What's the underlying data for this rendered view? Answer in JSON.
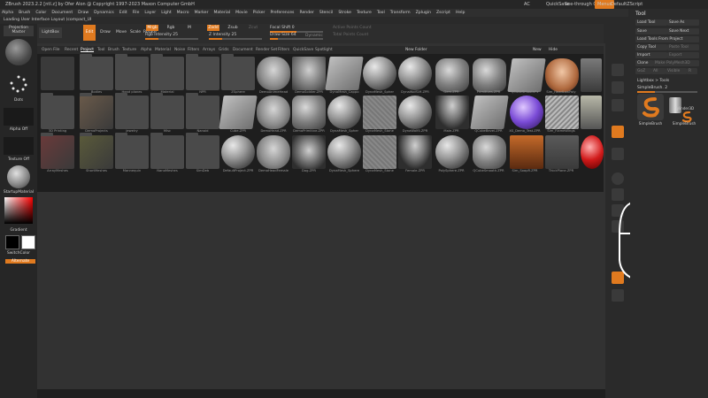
{
  "window": {
    "title": "ZBrush 2023.2.2 [ntl.z] by Ofer Alon @ Copyright 1997-2023 Maxon Computer GmbH",
    "right_items": [
      "AC",
      "QuickSave",
      "See-through 0",
      "Menus",
      "DefaultZScript"
    ]
  },
  "menubar": [
    "Alpha",
    "Brush",
    "Color",
    "Document",
    "Draw",
    "Dynamics",
    "Edit",
    "File",
    "Layer",
    "Light",
    "Macro",
    "Marker",
    "Material",
    "Movie",
    "Picker",
    "Preferences",
    "Render",
    "Stencil",
    "Stroke",
    "Texture",
    "Tool",
    "Transform",
    "Zplugin",
    "Zscript",
    "Help"
  ],
  "status": "Loading User Interface Layout (compact_UI",
  "left": {
    "projection": "Projection Master",
    "labels": [
      "Dots",
      "Alpha Off",
      "Texture Off",
      "StartupMaterial",
      "Gradient",
      "SwitchColor",
      "Alternate"
    ]
  },
  "shelf": {
    "lightbox": "LightBox",
    "buttons": [
      "Edit",
      "Draw",
      "Move",
      "Scale",
      "Rotate"
    ],
    "mrgb": "Mrgb",
    "rgb": "Rgb",
    "m": "M",
    "zadd": "Zadd",
    "zsub": "Zsub",
    "zcut": "Zcut",
    "rgb_intensity": "Rgb Intensity 25",
    "z_intensity": "Z Intensity 25",
    "focal_shift": "Focal Shift 0",
    "draw_size": "Draw Size 64",
    "dynamic": "Dynamic",
    "active_points": "Active Points Count",
    "total_points": "Total Points Count"
  },
  "lightbox": {
    "tabs": [
      "Open File",
      "Recent",
      "Project",
      "Tool",
      "Brush",
      "Texture",
      "Alpha",
      "Material",
      "Noise",
      "Filters",
      "Arrays",
      "Grids",
      "Document",
      "Render Set",
      "Filters",
      "QuickSave",
      "Spotlight"
    ],
    "active_tab": "Project",
    "right_buttons": [
      "New Folder",
      "New",
      "Hide"
    ],
    "row1": [
      "",
      "Bodies",
      "Head planes",
      "Material",
      "NPR",
      "ZSphere",
      "DemoAnimeHead",
      "DemoSoldier.ZPR",
      "DynaMesh_Cappo",
      "DynaMesh_Spher",
      "DynaWolf1M.ZPR",
      "Gem.ZPR",
      "Primitives.ZPR",
      "QCubeSmoothFx",
      "Sim_HeadLowPoly",
      "Sim_SuperHero",
      "ZBrushSim_Robe"
    ],
    "row2": [
      "3D Printing",
      "DemoProjects",
      "Jewelry",
      "Misc",
      "Nanoid",
      "Cube.ZPR",
      "DemoHead.ZPR",
      "DemoPrimitive.ZPR",
      "DynaMesh_Spher",
      "DynaMesh_Stone",
      "DynaWolf4.ZPR",
      "Male.ZPR",
      "QCubeBevel.ZPR",
      "XS_Demo_Test.ZPR",
      "Sim_FlameWings",
      "ZBrush_Bana"
    ],
    "row3": [
      "ArrayMeshes",
      "ShortMeshes",
      "Mannequin",
      "NanoMeshes",
      "SimDeb",
      "DefaultProject.ZPR",
      "DemoHeadFemale",
      "Dog.ZPR",
      "DynaMesh_Sphere",
      "DynaMesh_Stone",
      "Female.ZPR",
      "PolySphere.ZPR",
      "QCubeSmooth.ZPR",
      "Sim_SoapR.ZPR",
      "ThickPlane.ZPR"
    ]
  },
  "toolpanel": {
    "title": "Tool",
    "buttons": [
      "Load Tool",
      "Save As",
      "Save",
      "Save Next",
      "Load Tools From Project",
      "Copy Tool",
      "Paste Tool",
      "Import",
      "Export",
      "Clone",
      "Make PolyMesh3D",
      "GoZ",
      "All",
      "Visible",
      "R",
      "Lightbox > Tools"
    ],
    "current_tool": "SimpleBrush. 2",
    "tools": [
      "SimpleBrush",
      "Cylinder3D",
      "SimpleBrush"
    ]
  }
}
